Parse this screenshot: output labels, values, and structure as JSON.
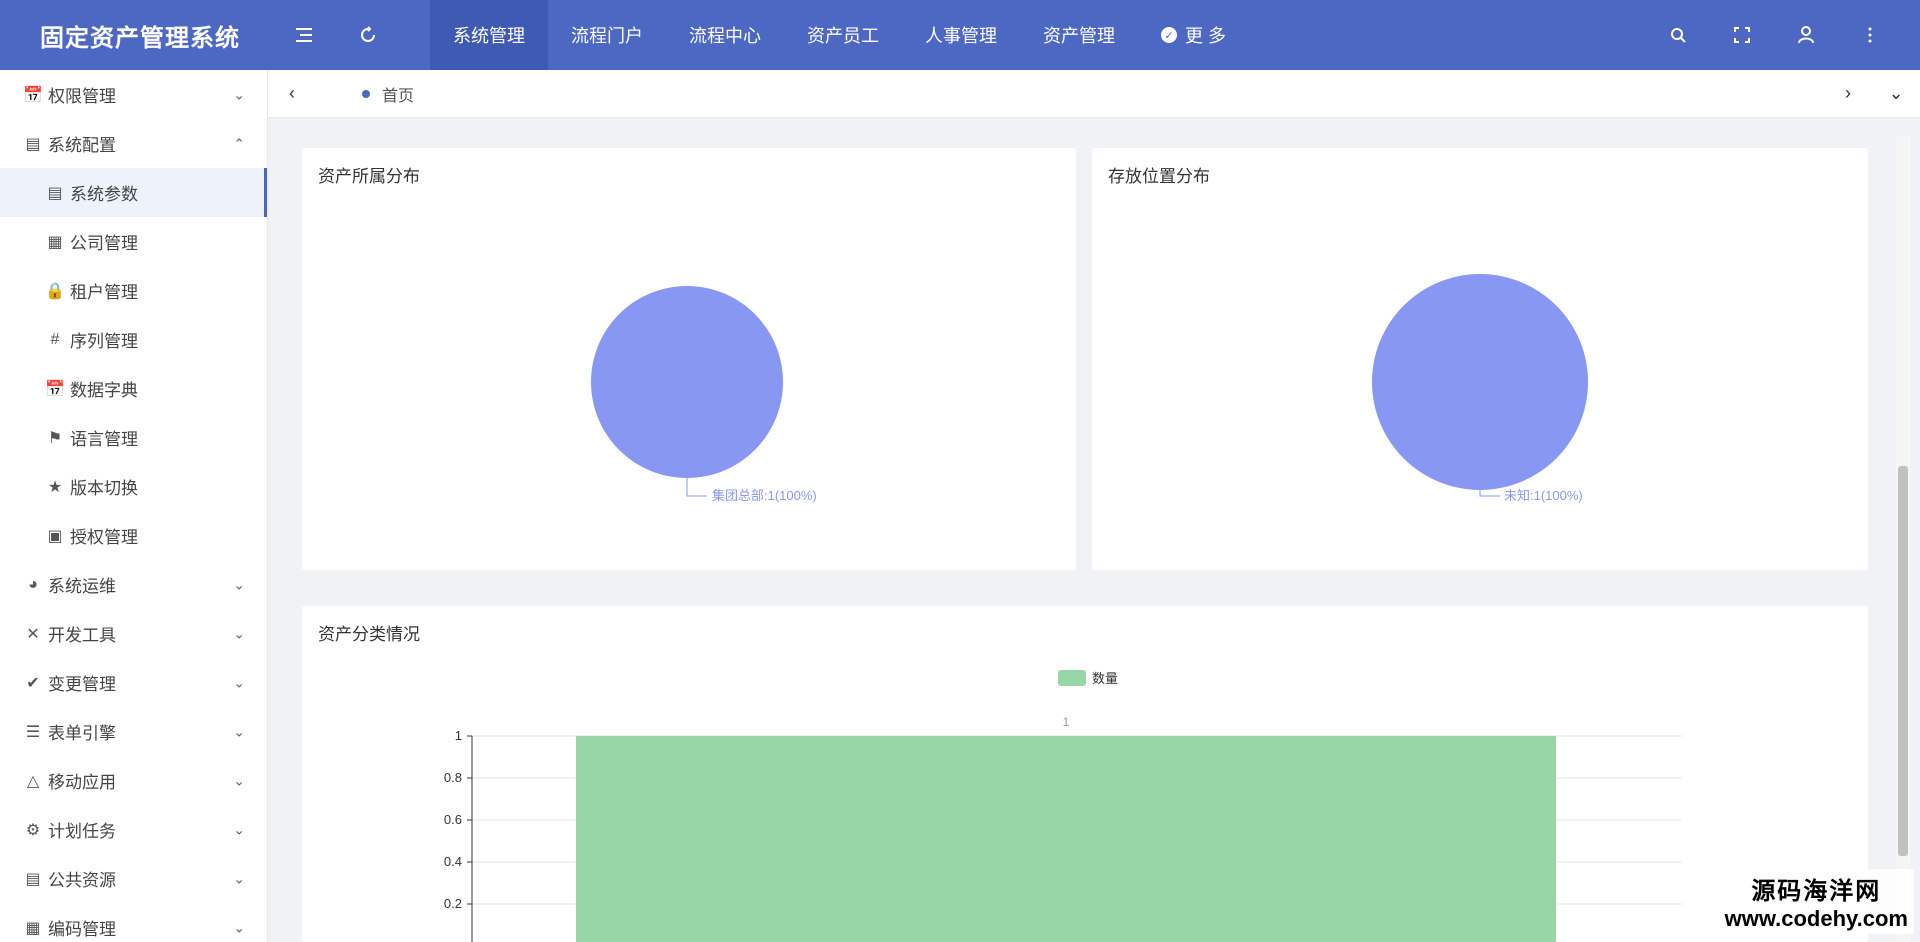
{
  "app": {
    "title": "固定资产管理系统"
  },
  "topnav": {
    "items": [
      "系统管理",
      "流程门户",
      "流程中心",
      "资产员工",
      "人事管理",
      "资产管理"
    ],
    "more_label": "更 多"
  },
  "sidebar": {
    "items": [
      {
        "label": "权限管理",
        "icon": "calendar-icon",
        "expanded": false
      },
      {
        "label": "系统配置",
        "icon": "server-icon",
        "expanded": true
      },
      {
        "label": "系统参数",
        "icon": "list-card-icon",
        "sub": true,
        "active": true
      },
      {
        "label": "公司管理",
        "icon": "building-icon",
        "sub": true
      },
      {
        "label": "租户管理",
        "icon": "lock-icon",
        "sub": true
      },
      {
        "label": "序列管理",
        "icon": "hash-icon",
        "sub": true
      },
      {
        "label": "数据字典",
        "icon": "calendar-icon",
        "sub": true
      },
      {
        "label": "语言管理",
        "icon": "flag-icon",
        "sub": true
      },
      {
        "label": "版本切换",
        "icon": "star-icon",
        "sub": true
      },
      {
        "label": "授权管理",
        "icon": "license-icon",
        "sub": true
      },
      {
        "label": "系统运维",
        "icon": "pie-icon",
        "expanded": false
      },
      {
        "label": "开发工具",
        "icon": "tools-icon",
        "expanded": false
      },
      {
        "label": "变更管理",
        "icon": "check-circle-icon",
        "expanded": false
      },
      {
        "label": "表单引擎",
        "icon": "bars-icon",
        "expanded": false
      },
      {
        "label": "移动应用",
        "icon": "cube-icon",
        "expanded": false
      },
      {
        "label": "计划任务",
        "icon": "gear-box-icon",
        "expanded": false
      },
      {
        "label": "公共资源",
        "icon": "server-icon",
        "expanded": false
      },
      {
        "label": "编码管理",
        "icon": "grid-icon",
        "expanded": false
      }
    ]
  },
  "tabs": {
    "items": [
      "首页"
    ]
  },
  "cards": {
    "asset_owner": {
      "title": "资产所属分布",
      "slice_label": "集团总部:1(100%)"
    },
    "location": {
      "title": "存放位置分布",
      "slice_label": "未知:1(100%)"
    },
    "category": {
      "title": "资产分类情况",
      "legend": "数量",
      "bar_label": "1"
    }
  },
  "chart_data": [
    {
      "type": "pie",
      "title": "资产所属分布",
      "slices": [
        {
          "name": "集团总部",
          "value": 1,
          "percent": 100
        }
      ],
      "color": "#8797f2"
    },
    {
      "type": "pie",
      "title": "存放位置分布",
      "slices": [
        {
          "name": "未知",
          "value": 1,
          "percent": 100
        }
      ],
      "color": "#8797f2"
    },
    {
      "type": "bar",
      "title": "资产分类情况",
      "series": [
        {
          "name": "数量",
          "values": [
            1
          ]
        }
      ],
      "categories": [
        ""
      ],
      "ylim": [
        0,
        1
      ],
      "yticks": [
        "1",
        "0.8",
        "0.6",
        "0.4",
        "0.2"
      ],
      "color": "#98d6a6",
      "legend_position": "top-center",
      "grid": true
    }
  ],
  "watermark": {
    "line1": "源码海洋网",
    "line2": "www.codehy.com"
  },
  "colors": {
    "header": "#4c68c3",
    "accent": "#4c68c3"
  }
}
